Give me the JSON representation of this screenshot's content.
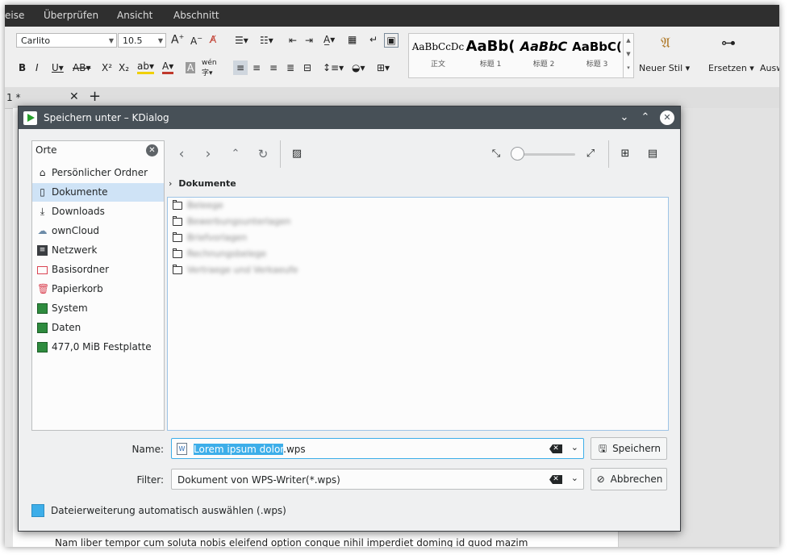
{
  "app": {
    "menu": [
      "eise",
      "Überprüfen",
      "Ansicht",
      "Abschnitt"
    ],
    "font_name": "Carlito",
    "font_size": "10.5",
    "styles": [
      {
        "sample": "AaBbCcDc",
        "label": "正文"
      },
      {
        "sample": "AaBb(",
        "label": "标题 1"
      },
      {
        "sample": "AaBbC",
        "label": "标题 2"
      },
      {
        "sample": "AaBbC(",
        "label": "标题 3"
      }
    ],
    "new_style": "Neuer Stil",
    "replace": "Ersetzen",
    "select_partial": "Ausw",
    "tab_label": "1 *",
    "doc_text": "Nam liber tempor cum soluta nobis eleifend option congue nihil imperdiet doming id quod mazim"
  },
  "dialog": {
    "title": "Speichern unter – KDialog",
    "places_header": "Orte",
    "places": [
      {
        "label": "Persönlicher Ordner",
        "icon": "home-icon"
      },
      {
        "label": "Dokumente",
        "icon": "document-icon"
      },
      {
        "label": "Downloads",
        "icon": "download-icon"
      },
      {
        "label": "ownCloud",
        "icon": "cloud-icon"
      },
      {
        "label": "Netzwerk",
        "icon": "network-icon"
      },
      {
        "label": "Basisordner",
        "icon": "folder-red-icon"
      },
      {
        "label": "Papierkorb",
        "icon": "trash-icon"
      },
      {
        "label": "System",
        "icon": "drive-icon"
      },
      {
        "label": "Daten",
        "icon": "drive-icon"
      },
      {
        "label": "477,0 MiB Festplatte",
        "icon": "drive-icon"
      }
    ],
    "selected_place": "Dokumente",
    "breadcrumb": "Dokumente",
    "folders": [
      "Beleege",
      "Bewerbungsunterlagen",
      "Briefvorlagen",
      "Rechnungsbelege",
      "Vertraege und Verkaeufe"
    ],
    "name_label": "Name:",
    "filename_selected": "Lorem ipsum dolor",
    "filename_ext": ".wps",
    "filter_label": "Filter:",
    "filter_value": "Dokument von WPS-Writer(*.wps)",
    "save_button": "Speichern",
    "cancel_button": "Abbrechen",
    "auto_ext_label": "Dateierweiterung automatisch auswählen (.wps)",
    "auto_ext_checked": true,
    "colors": {
      "accent": "#3daee9",
      "titlebar": "#475057",
      "window": "#eff0f1"
    }
  }
}
